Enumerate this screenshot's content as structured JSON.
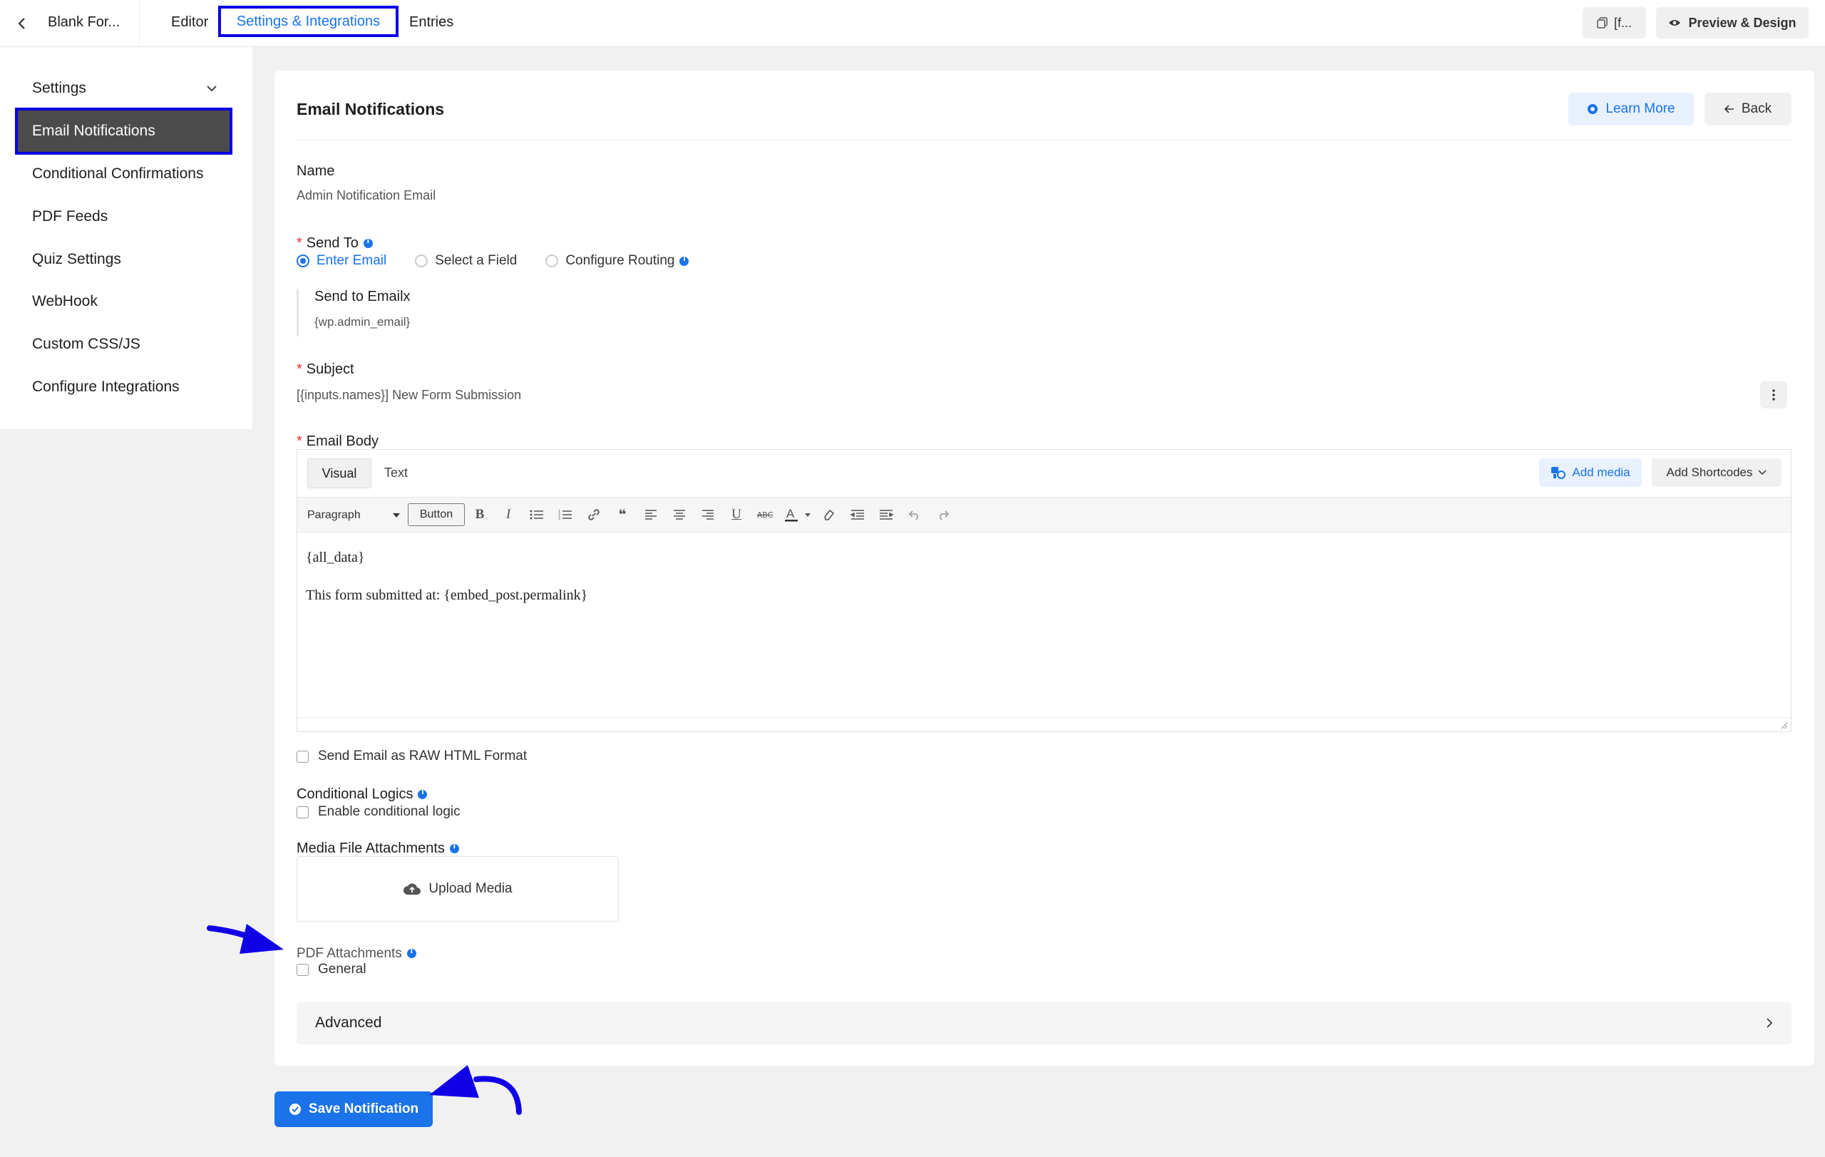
{
  "topbar": {
    "form_title": "Blank For...",
    "tabs": [
      {
        "label": "Editor"
      },
      {
        "label": "Settings & Integrations"
      },
      {
        "label": "Entries"
      }
    ],
    "shortcode_button": "[f...",
    "preview_button": "Preview & Design"
  },
  "sidebar": {
    "settings_label": "Settings",
    "items": [
      {
        "label": "Email Notifications"
      },
      {
        "label": "Conditional Confirmations"
      },
      {
        "label": "PDF Feeds"
      },
      {
        "label": "Quiz Settings"
      },
      {
        "label": "WebHook"
      },
      {
        "label": "Custom CSS/JS"
      },
      {
        "label": "Configure Integrations"
      }
    ]
  },
  "card": {
    "title": "Email Notifications",
    "learn_more": "Learn More",
    "back": "Back",
    "name_label": "Name",
    "name_value": "Admin Notification Email",
    "send_to_label": "Send To",
    "send_to_options": [
      {
        "label": "Enter Email",
        "selected": true
      },
      {
        "label": "Select a Field",
        "selected": false
      },
      {
        "label": "Configure Routing",
        "selected": false
      }
    ],
    "send_to_email_label": "Send to Emailx",
    "send_to_email_value": "{wp.admin_email}",
    "subject_label": "Subject",
    "subject_value": "[{inputs.names}] New Form Submission",
    "email_body_label": "Email Body",
    "editor": {
      "tab_visual": "Visual",
      "tab_text": "Text",
      "add_media": "Add media",
      "add_shortcodes": "Add Shortcodes",
      "format_select": "Paragraph",
      "button_label": "Button",
      "content": [
        "{all_data}",
        "This form submitted at: {embed_post.permalink}"
      ]
    },
    "raw_html_label": "Send Email as RAW HTML Format",
    "conditional_label": "Conditional Logics",
    "conditional_checkbox": "Enable conditional logic",
    "media_label": "Media File Attachments",
    "upload_media": "Upload Media",
    "pdf_label": "PDF Attachments",
    "pdf_checkbox": "General",
    "advanced_label": "Advanced"
  },
  "save_button": "Save Notification",
  "colors": {
    "accent": "#1a73e8",
    "highlight": "#0d00e3",
    "active_sidebar": "#4b4b4b",
    "required": "#e03131"
  }
}
